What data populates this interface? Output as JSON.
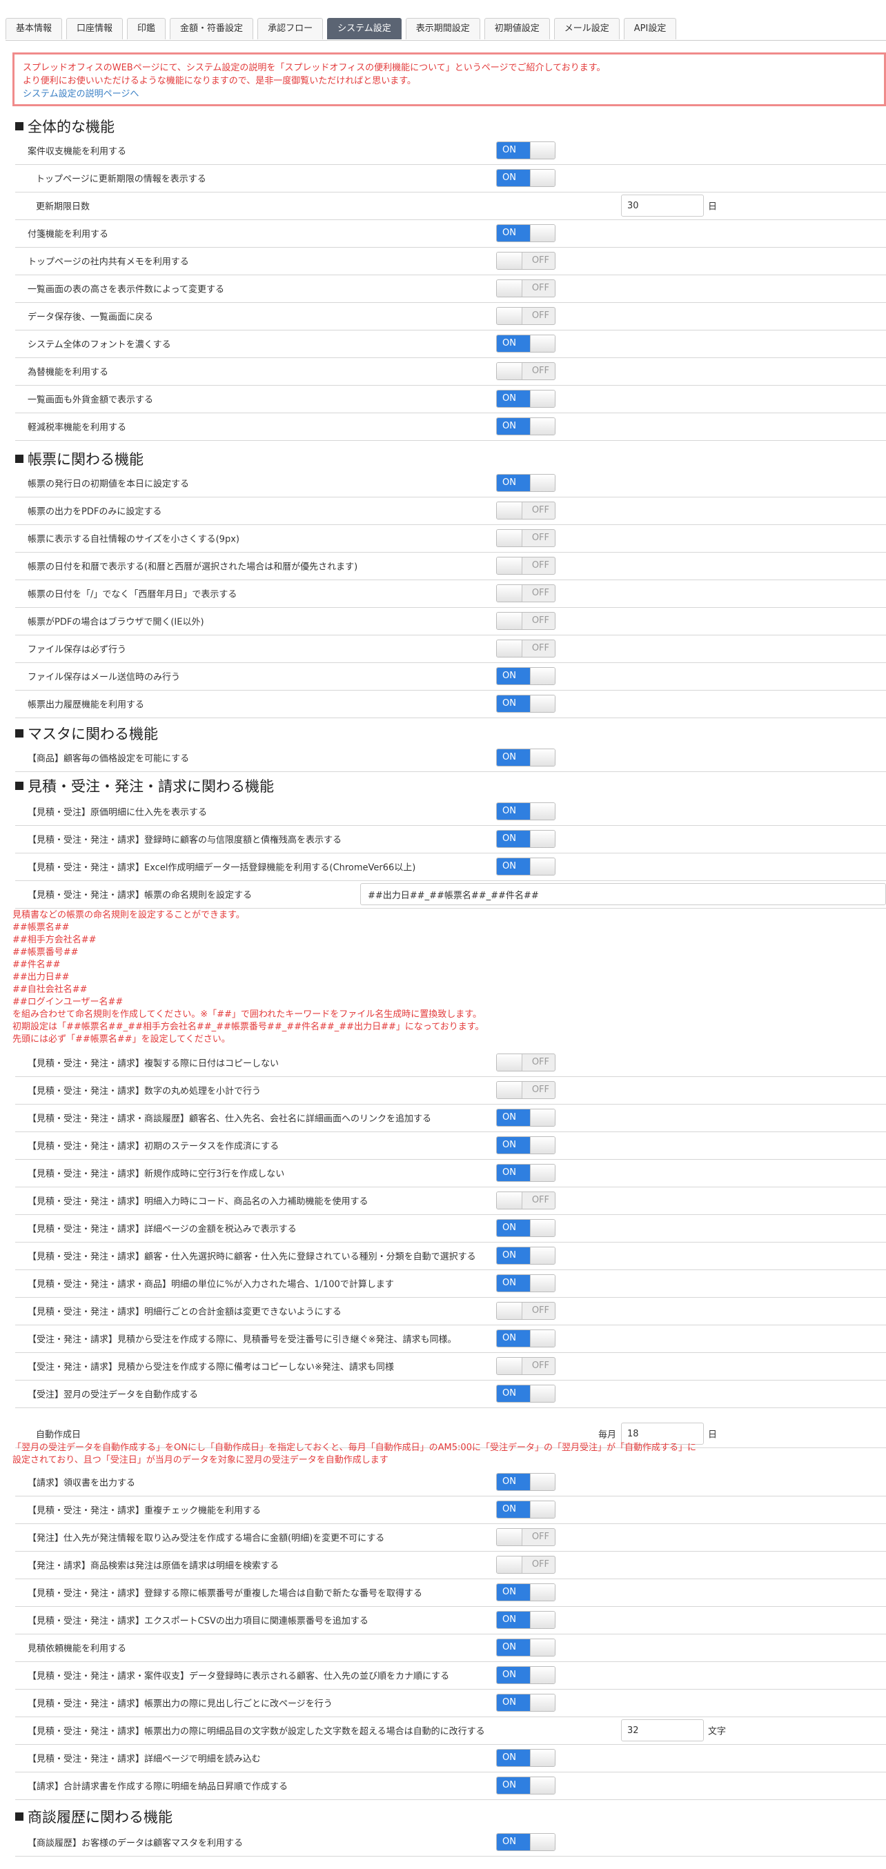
{
  "tabs": [
    "基本情報",
    "口座情報",
    "印鑑",
    "金額・符番設定",
    "承認フロー",
    "システム設定",
    "表示期間設定",
    "初期値設定",
    "メール設定",
    "API設定"
  ],
  "active_tab": "システム設定",
  "notice": {
    "line1": "スプレッドオフィスのWEBページにて、システム設定の説明を「スプレッドオフィスの便利機能について」というページでご紹介しております。",
    "line2": "より便利にお使いいただけるような機能になりますので、是非一度御覧いただければと思います。",
    "link": "システム設定の説明ページへ"
  },
  "toggle_text": {
    "on": "ON",
    "off": "OFF"
  },
  "headings": [
    "全体的な機能",
    "帳票に関わる機能",
    "マスタに関わる機能",
    "見積・受注・発注・請求に関わる機能",
    "商談履歴に関わる機能"
  ],
  "rows": [
    {
      "label": "案件収支機能を利用する",
      "value": "on"
    },
    {
      "label": "トップページに更新期限の情報を表示する",
      "value": "on"
    },
    {
      "label": "更新期限日数",
      "input": "30",
      "unit": "日"
    },
    {
      "label": "付箋機能を利用する",
      "value": "on"
    },
    {
      "label": "トップページの社内共有メモを利用する",
      "value": "off"
    },
    {
      "label": "一覧画面の表の高さを表示件数によって変更する",
      "value": "off"
    },
    {
      "label": "データ保存後、一覧画面に戻る",
      "value": "off"
    },
    {
      "label": "システム全体のフォントを濃くする",
      "value": "on"
    },
    {
      "label": "為替機能を利用する",
      "value": "off"
    },
    {
      "label": "一覧画面も外貨金額で表示する",
      "value": "on"
    },
    {
      "label": "軽減税率機能を利用する",
      "value": "on"
    },
    {
      "label": "帳票の発行日の初期値を本日に設定する",
      "value": "on"
    },
    {
      "label": "帳票の出力をPDFのみに設定する",
      "value": "off"
    },
    {
      "label": "帳票に表示する自社情報のサイズを小さくする(9px)",
      "value": "off"
    },
    {
      "label": "帳票の日付を和暦で表示する(和暦と西暦が選択された場合は和暦が優先されます)",
      "value": "off"
    },
    {
      "label": "帳票の日付を「/」でなく「西暦年月日」で表示する",
      "value": "off"
    },
    {
      "label": "帳票がPDFの場合はブラウザで開く(IE以外)",
      "value": "off"
    },
    {
      "label": "ファイル保存は必ず行う",
      "value": "off"
    },
    {
      "label": "ファイル保存はメール送信時のみ行う",
      "value": "on"
    },
    {
      "label": "帳票出力履歴機能を利用する",
      "value": "on"
    },
    {
      "label": "【商品】顧客毎の価格設定を可能にする",
      "value": "on"
    },
    {
      "label": "【見積・受注】原価明細に仕入先を表示する",
      "value": "on"
    },
    {
      "label": "【見積・受注・発注・請求】登録時に顧客の与信限度額と債権残高を表示する",
      "value": "on"
    },
    {
      "label": "【見積・受注・発注・請求】Excel作成明細データ一括登録機能を利用する(ChromeVer66以上)",
      "value": "on"
    },
    {
      "label": "【見積・受注・発注・請求】帳票の命名規則を設定する",
      "text": "##出力日##_##帳票名##_##件名##"
    },
    {
      "label": "【見積・受注・発注・請求】複製する際に日付はコピーしない",
      "value": "off"
    },
    {
      "label": "【見積・受注・発注・請求】数字の丸め処理を小計で行う",
      "value": "off"
    },
    {
      "label": "【見積・受注・発注・請求・商談履歴】顧客名、仕入先名、会社名に詳細画面へのリンクを追加する",
      "value": "on"
    },
    {
      "label": "【見積・受注・発注・請求】初期のステータスを作成済にする",
      "value": "on"
    },
    {
      "label": "【見積・受注・発注・請求】新規作成時に空行3行を作成しない",
      "value": "on"
    },
    {
      "label": "【見積・受注・発注・請求】明細入力時にコード、商品名の入力補助機能を使用する",
      "value": "off"
    },
    {
      "label": "【見積・受注・発注・請求】詳細ページの金額を税込みで表示する",
      "value": "on"
    },
    {
      "label": "【見積・受注・発注・請求】顧客・仕入先選択時に顧客・仕入先に登録されている種別・分類を自動で選択する",
      "value": "on"
    },
    {
      "label": "【見積・受注・発注・請求・商品】明細の単位に%が入力された場合、1/100で計算します",
      "value": "on"
    },
    {
      "label": "【見積・受注・発注・請求】明細行ごとの合計金額は変更できないようにする",
      "value": "off"
    },
    {
      "label": "【受注・発注・請求】見積から受注を作成する際に、見積番号を受注番号に引き継ぐ※発注、請求も同様。",
      "value": "on"
    },
    {
      "label": "【受注・発注・請求】見積から受注を作成する際に備考はコピーしない※発注、請求も同様",
      "value": "off"
    },
    {
      "label": "【受注】翌月の受注データを自動作成する",
      "value": "on"
    },
    {
      "label": "自動作成日",
      "prefix": "毎月",
      "input": "18",
      "unit": "日"
    },
    {
      "label": "【請求】領収書を出力する",
      "value": "on"
    },
    {
      "label": "【見積・受注・発注・請求】重複チェック機能を利用する",
      "value": "on"
    },
    {
      "label": "【発注】仕入先が発注情報を取り込み受注を作成する場合に金額(明細)を変更不可にする",
      "value": "off"
    },
    {
      "label": "【発注・請求】商品検索は発注は原価を請求は明細を検索する",
      "value": "off"
    },
    {
      "label": "【見積・受注・発注・請求】登録する際に帳票番号が重複した場合は自動で新たな番号を取得する",
      "value": "on"
    },
    {
      "label": "【見積・受注・発注・請求】エクスポートCSVの出力項目に関連帳票番号を追加する",
      "value": "on"
    },
    {
      "label": "見積依頼機能を利用する",
      "value": "on"
    },
    {
      "label": "【見積・受注・発注・請求・案件収支】データ登録時に表示される顧客、仕入先の並び順をカナ順にする",
      "value": "on"
    },
    {
      "label": "【見積・受注・発注・請求】帳票出力の際に見出し行ごとに改ページを行う",
      "value": "on"
    },
    {
      "label": "【見積・受注・発注・請求】帳票出力の際に明細品目の文字数が設定した文字数を超える場合は自動的に改行する",
      "input": "32",
      "unit": "文字"
    },
    {
      "label": "【見積・受注・発注・請求】詳細ページで明細を読み込む",
      "value": "on"
    },
    {
      "label": "【請求】合計請求書を作成する際に明細を納品日昇順で作成する",
      "value": "on"
    },
    {
      "label": "【商談履歴】お客様のデータは顧客マスタを利用する",
      "value": "on"
    }
  ],
  "naming_note": [
    "見積書などの帳票の命名規則を設定することができます。",
    "##帳票名##",
    "##相手方会社名##",
    "##帳票番号##",
    "##件名##",
    "##出力日##",
    "##自社会社名##",
    "##ログインユーザー名##",
    "を組み合わせて命名規則を作成してください。※「##」で囲われたキーワードをファイル名生成時に置換致します。",
    "初期設定は「##帳票名##_##相手方会社名##_##帳票番号##_##件名##_##出力日##」になっております。",
    "先頭には必ず「##帳票名##」を設定してください。"
  ],
  "auto_note": [
    "「翌月の受注データを自動作成する」をONにし「自動作成日」を指定しておくと、毎月「自動作成日」のAM5:00に「受注データ」の「翌月受注」が「自動作成する」に",
    "設定されており、且つ「受注日」が当月のデータを対象に翌月の受注データを自動作成します"
  ]
}
